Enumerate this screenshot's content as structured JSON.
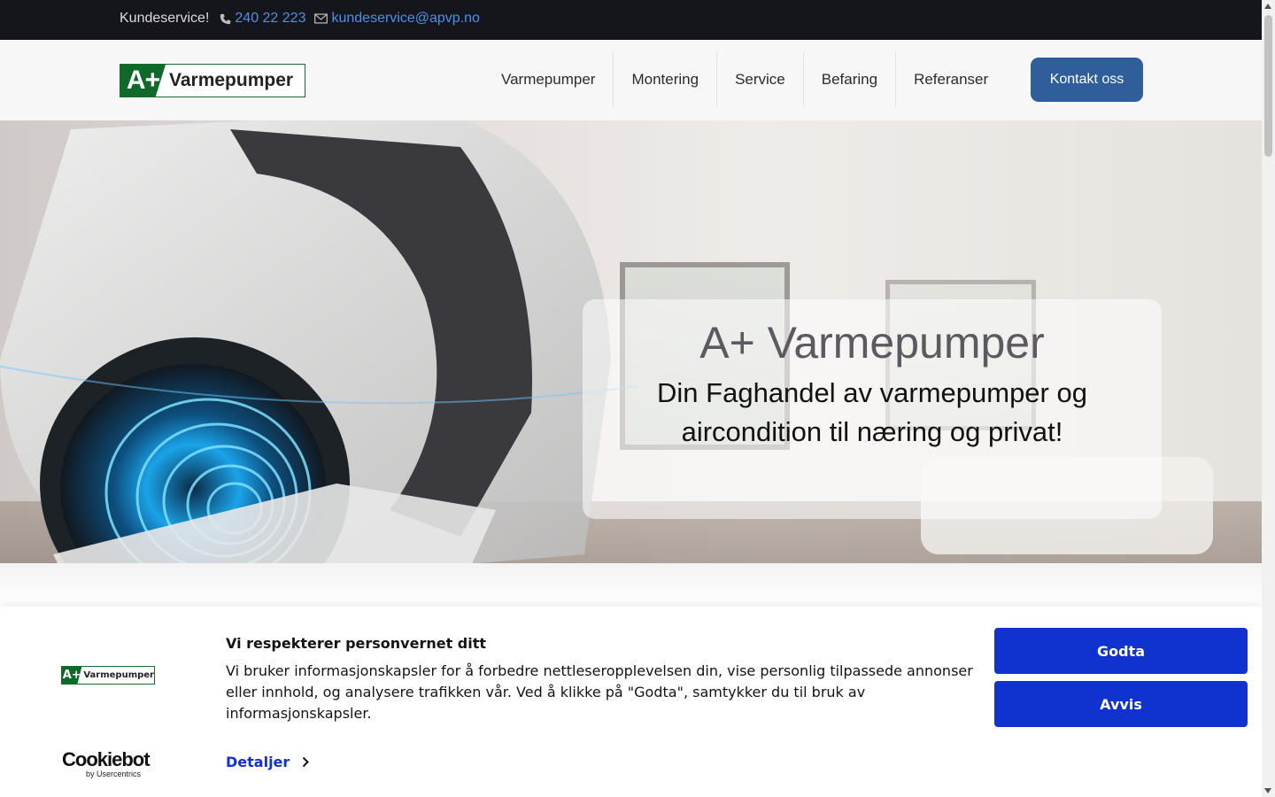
{
  "topbar": {
    "service_label": "Kundeservice!",
    "phone": "240 22 223",
    "email": "kundeservice@apvp.no",
    "phone_icon": "phone-icon",
    "email_icon": "envelope-icon"
  },
  "header": {
    "logo_mark": "A+",
    "logo_text": "Varmepumper",
    "nav": [
      "Varmepumper",
      "Montering",
      "Service",
      "Befaring",
      "Referanser"
    ],
    "cta": "Kontakt oss"
  },
  "hero": {
    "title": "A+ Varmepumper",
    "subtitle": "Din Faghandel av varmepumper og aircondition til næring og privat!"
  },
  "cookie_banner": {
    "logo_mark": "A+",
    "logo_text": "Varmepumper",
    "title": "Vi respekterer personvernet ditt",
    "body": "Vi bruker informasjonskapsler for å forbedre nettleseropplevelsen din, vise personlig tilpassede annonser eller innhold, og analysere trafikken vår. Ved å klikke på \"Godta\", samtykker du til bruk av informasjonskapsler.",
    "details_label": "Detaljer",
    "accept_label": "Godta",
    "reject_label": "Avvis",
    "provider_name": "Cookiebot",
    "provider_sub": "by Usercentrics"
  },
  "colors": {
    "topbar_bg": "#15151c",
    "link": "#4f8fe8",
    "cta_bg": "#2f5e9a",
    "cookie_button": "#1032cf",
    "brand_green": "#0f6a2a"
  }
}
